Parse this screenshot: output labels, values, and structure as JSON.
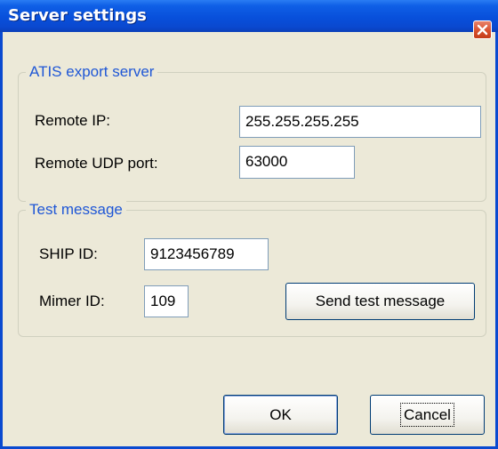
{
  "window": {
    "title": "Server settings",
    "close_icon": "close-icon"
  },
  "atis": {
    "group_title": "ATIS export server",
    "remote_ip_label": "Remote IP:",
    "remote_ip_value": "255.255.255.255",
    "remote_port_label": "Remote UDP port:",
    "remote_port_value": "63000"
  },
  "test": {
    "group_title": "Test message",
    "ship_id_label": "SHIP ID:",
    "ship_id_value": "9123456789",
    "mimer_id_label": "Mimer ID:",
    "mimer_id_value": "109",
    "send_label": "Send test message"
  },
  "footer": {
    "ok_label": "OK",
    "cancel_label": "Cancel"
  },
  "colors": {
    "title_bar": "#0a4ad0",
    "group_title": "#1f57d6",
    "window_bg": "#ece9d8"
  }
}
